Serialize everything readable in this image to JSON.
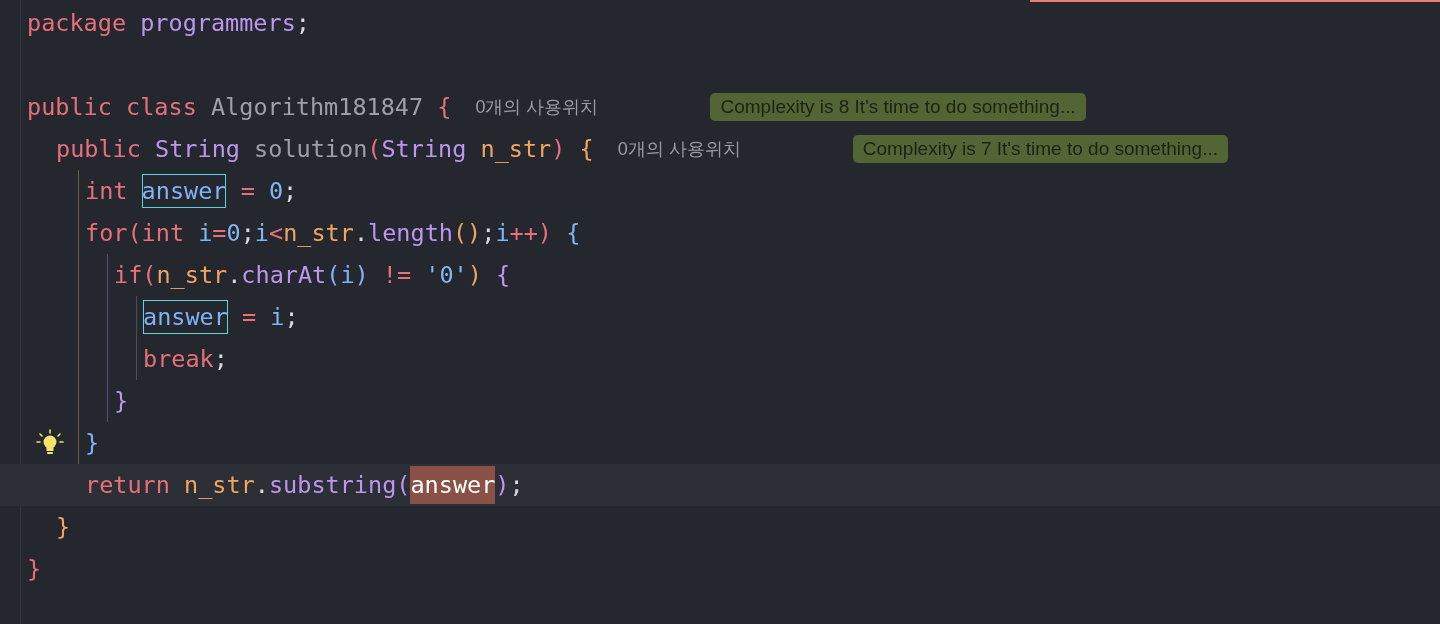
{
  "lines": [
    {
      "tokens": [
        {
          "kind": "keyword",
          "text": "package "
        },
        {
          "kind": "package",
          "text": "programmers"
        },
        {
          "kind": "plain",
          "text": ";"
        }
      ]
    },
    {
      "blank": true
    },
    {
      "tokens": [
        {
          "kind": "keyword",
          "text": "public class "
        },
        {
          "kind": "declaration",
          "text": "Algorithm181847 "
        },
        {
          "kind": "red",
          "text": "{"
        }
      ],
      "hint": "0개의 사용위치",
      "badge": "Complexity is 8 It's time to do something...",
      "children": [
        {
          "tokens": [
            {
              "kind": "keyword",
              "text": "public "
            },
            {
              "kind": "type",
              "text": "String "
            },
            {
              "kind": "declaration",
              "text": "solution"
            },
            {
              "kind": "red",
              "text": "("
            },
            {
              "kind": "type",
              "text": "String "
            },
            {
              "kind": "parameter",
              "text": "n_str"
            },
            {
              "kind": "red",
              "text": ") "
            },
            {
              "kind": "orange",
              "text": "{"
            }
          ],
          "hint": "0개의 사용위치",
          "badge": "Complexity is 7 It's time to do something...",
          "children": [
            {
              "tokens": [
                {
                  "kind": "keyword",
                  "text": "int "
                },
                {
                  "kind": "local",
                  "text": "answer",
                  "boxed": true
                },
                {
                  "kind": "operator",
                  "text": " = "
                },
                {
                  "kind": "number",
                  "text": "0"
                },
                {
                  "kind": "plain",
                  "text": ";"
                }
              ]
            },
            {
              "tokens": [
                {
                  "kind": "keyword",
                  "text": "for"
                },
                {
                  "kind": "red",
                  "text": "("
                },
                {
                  "kind": "keyword",
                  "text": "int "
                },
                {
                  "kind": "local",
                  "text": "i"
                },
                {
                  "kind": "operator",
                  "text": "="
                },
                {
                  "kind": "number",
                  "text": "0"
                },
                {
                  "kind": "plain",
                  "text": ";"
                },
                {
                  "kind": "local",
                  "text": "i"
                },
                {
                  "kind": "operator",
                  "text": "<"
                },
                {
                  "kind": "parameter",
                  "text": "n_str"
                },
                {
                  "kind": "plain",
                  "text": "."
                },
                {
                  "kind": "method",
                  "text": "length"
                },
                {
                  "kind": "orange",
                  "text": "()"
                },
                {
                  "kind": "plain",
                  "text": ";"
                },
                {
                  "kind": "local",
                  "text": "i"
                },
                {
                  "kind": "operator",
                  "text": "++"
                },
                {
                  "kind": "red",
                  "text": ") "
                },
                {
                  "kind": "blue",
                  "text": "{"
                }
              ],
              "children": [
                {
                  "tokens": [
                    {
                      "kind": "keyword",
                      "text": "if"
                    },
                    {
                      "kind": "red",
                      "text": "("
                    },
                    {
                      "kind": "parameter",
                      "text": "n_str"
                    },
                    {
                      "kind": "plain",
                      "text": "."
                    },
                    {
                      "kind": "method",
                      "text": "charAt"
                    },
                    {
                      "kind": "blue",
                      "text": "("
                    },
                    {
                      "kind": "local",
                      "text": "i"
                    },
                    {
                      "kind": "blue",
                      "text": ")"
                    },
                    {
                      "kind": "operator",
                      "text": " != "
                    },
                    {
                      "kind": "number",
                      "text": "'0'"
                    },
                    {
                      "kind": "orange",
                      "text": ") "
                    },
                    {
                      "kind": "purple",
                      "text": "{"
                    }
                  ],
                  "children": [
                    {
                      "tokens": [
                        {
                          "kind": "local",
                          "text": "answer",
                          "boxed": true
                        },
                        {
                          "kind": "operator",
                          "text": " = "
                        },
                        {
                          "kind": "local",
                          "text": "i"
                        },
                        {
                          "kind": "plain",
                          "text": ";"
                        }
                      ]
                    },
                    {
                      "tokens": [
                        {
                          "kind": "keyword",
                          "text": "break"
                        },
                        {
                          "kind": "plain",
                          "text": ";"
                        }
                      ]
                    }
                  ]
                },
                {
                  "tokens": [
                    {
                      "kind": "purple",
                      "text": "}"
                    }
                  ]
                }
              ]
            },
            {
              "tokens": [
                {
                  "kind": "blue",
                  "text": "}"
                }
              ],
              "bulb": true
            },
            {
              "tokens": [
                {
                  "kind": "keyword",
                  "text": "return "
                },
                {
                  "kind": "parameter",
                  "text": "n_str"
                },
                {
                  "kind": "plain",
                  "text": "."
                },
                {
                  "kind": "method",
                  "text": "substring"
                },
                {
                  "kind": "purple",
                  "text": "("
                },
                {
                  "kind": "local",
                  "text": "answer",
                  "selected": true
                },
                {
                  "kind": "purple",
                  "text": ")"
                },
                {
                  "kind": "plain",
                  "text": ";"
                }
              ],
              "current": true
            }
          ]
        },
        {
          "tokens": [
            {
              "kind": "orange",
              "text": "}"
            }
          ]
        }
      ]
    },
    {
      "tokens": [
        {
          "kind": "red",
          "text": "}"
        }
      ]
    }
  ]
}
